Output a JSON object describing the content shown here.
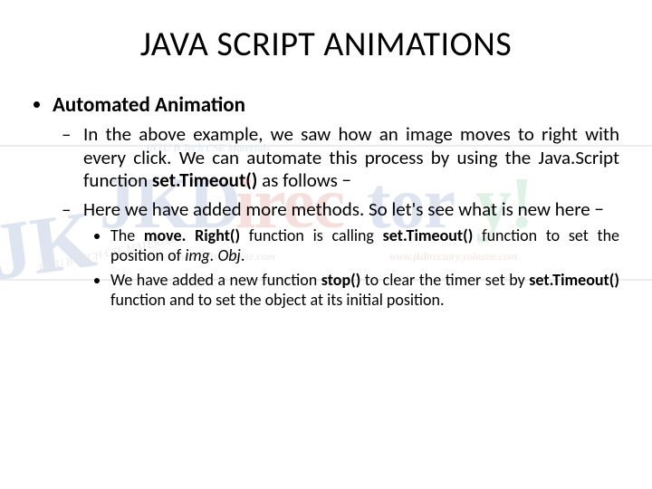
{
  "title": "JAVA SCRIPT ANIMATIONS",
  "section": "Automated Animation",
  "para1_a": "In the above example, we saw how an image moves to right with every click. We can automate this process by using the Java.Script function ",
  "para1_b": "set.Timeout()",
  "para1_c": " as follows −",
  "para2": "Here we have added more methods. So let's see what is new here −",
  "sub1_a": "The ",
  "sub1_b": "move. Right()",
  "sub1_c": " function is calling ",
  "sub1_d": "set.Timeout()",
  "sub1_e": " function to set the position of ",
  "sub1_f": "img. Obj",
  "sub1_g": ".",
  "sub2_a": "We have added a new function ",
  "sub2_b": "stop()",
  "sub2_c": " to clear the timer set by ",
  "sub2_d": "set.Timeout()",
  "sub2_e": " function and to set the object at its initial position.",
  "wm": {
    "header": "JNTU B Tech CSE Materials",
    "url1": "www.jkmaterials.yolasite.com",
    "url2": "www.jkdirectory.yolasite.com",
    "side": "JNTU B TECH CSE MATERIALS"
  }
}
